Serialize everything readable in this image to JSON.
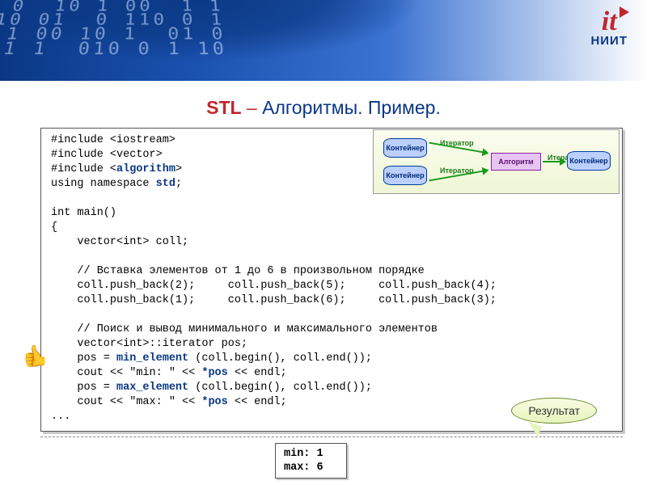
{
  "logo": {
    "mark": "it",
    "sub": "НИИТ"
  },
  "title": {
    "stl": "STL",
    "dash": " – ",
    "rest": "Алгоритмы. Пример."
  },
  "code": {
    "l1a": "#include <iostream>",
    "l2a": "#include <vector>",
    "l3a": "#include <",
    "l3b": "algorithm",
    "l3c": ">",
    "l4a": "using namespace ",
    "l4b": "std",
    "l4c": ";",
    "blank1": "",
    "l5a": "int main()",
    "l6a": "{",
    "l7a": "    vector<int> coll;",
    "blank2": "",
    "l8a": "    // Вставка элементов от 1 до 6 в произвольном порядке",
    "l9a": "    coll.push_back(2);     coll.push_back(5);     coll.push_back(4);",
    "l10a": "    coll.push_back(1);     coll.push_back(6);     coll.push_back(3);",
    "blank3": "",
    "l11a": "    // Поиск и вывод минимального и максимального элементов",
    "l12a": "    vector<int>::iterator pos;",
    "l13a": "    pos = ",
    "l13b": "min_element",
    "l13c": " (coll.begin(), coll.end());",
    "l14a": "    cout << \"min: \" << ",
    "l14b": "*pos",
    "l14c": " << endl;",
    "l15a": "    pos = ",
    "l15b": "max_element",
    "l15c": " (coll.begin(), coll.end());",
    "l16a": "    cout << \"max: \" << ",
    "l16b": "*pos",
    "l16c": " << endl;",
    "l17a": "..."
  },
  "thumb": "👍",
  "result_label": "Результат",
  "output": {
    "line1": "min: 1",
    "line2": "max: 6"
  },
  "diagram": {
    "container": "Контейнер",
    "iterator": "Итератор",
    "algorithm": "Алгоритм"
  },
  "bg_digits": " 0  10 1 00  1 1\n10 01  0 110 0 1\n 1 00 10 1  01 0\n01 1  010 0 1 10"
}
